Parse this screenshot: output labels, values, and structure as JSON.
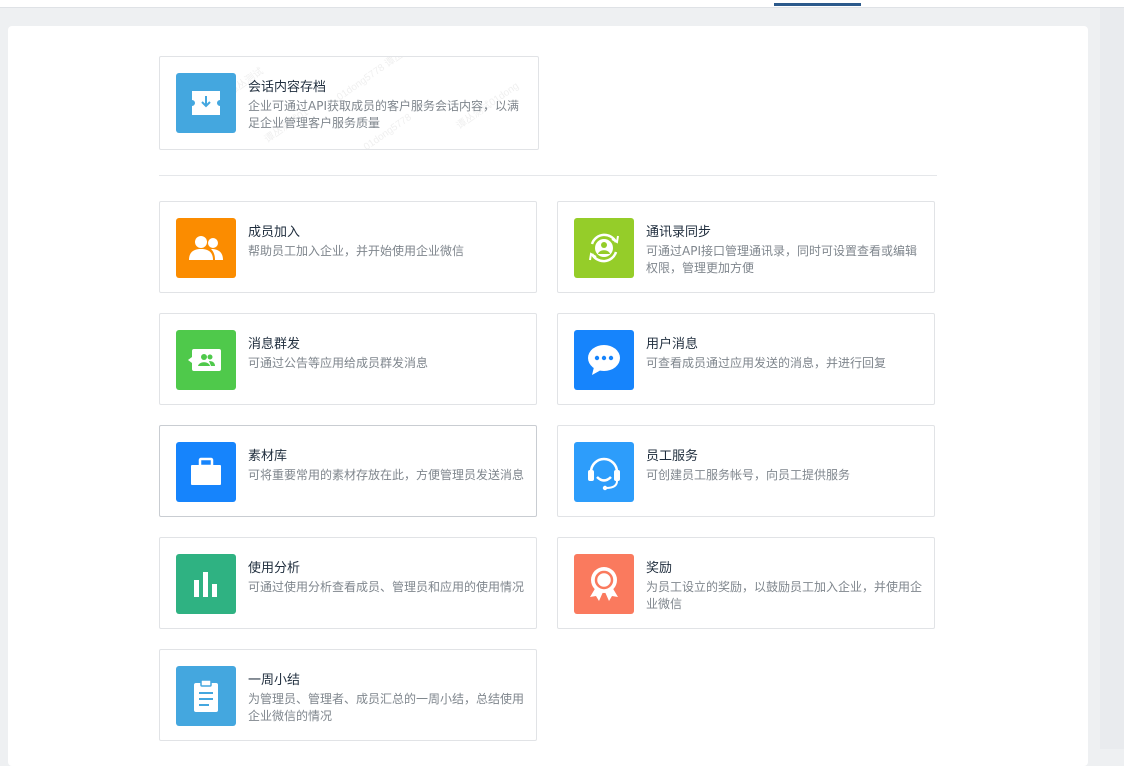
{
  "archive_card": {
    "title": "会话内容存档",
    "desc": "企业可通过API获取成员的客户服务会话内容，以满足企业管理客户服务质量",
    "icon": "download-icon",
    "color": "#44a7df"
  },
  "cards": [
    {
      "title": "成员加入",
      "desc": "帮助员工加入企业，并开始使用企业微信",
      "icon": "users-icon",
      "color": "#fb8c00"
    },
    {
      "title": "通讯录同步",
      "desc": "可通过API接口管理通讯录，同时可设置查看或编辑权限，管理更加方便",
      "icon": "contact-sync-icon",
      "color": "#95cd29"
    },
    {
      "title": "消息群发",
      "desc": "可通过公告等应用给成员群发消息",
      "icon": "broadcast-icon",
      "color": "#4fc94b"
    },
    {
      "title": "用户消息",
      "desc": "可查看成员通过应用发送的消息，并进行回复",
      "icon": "chat-bubble-icon",
      "color": "#1684fc"
    },
    {
      "title": "素材库",
      "desc": "可将重要常用的素材存放在此，方便管理员发送消息",
      "icon": "briefcase-icon",
      "color": "#1684fc"
    },
    {
      "title": "员工服务",
      "desc": "可创建员工服务帐号，向员工提供服务",
      "icon": "headset-icon",
      "color": "#2d9dfb"
    },
    {
      "title": "使用分析",
      "desc": "可通过使用分析查看成员、管理员和应用的使用情况",
      "icon": "bar-chart-icon",
      "color": "#2fb282"
    },
    {
      "title": "奖励",
      "desc": "为员工设立的奖励，以鼓励员工加入企业，并使用企业微信",
      "icon": "award-icon",
      "color": "#fa7a5e"
    },
    {
      "title": "一周小结",
      "desc": "为管理员、管理者、成员汇总的一周小结，总结使用企业微信的情况",
      "icon": "clipboard-icon",
      "color": "#44a7df"
    }
  ]
}
